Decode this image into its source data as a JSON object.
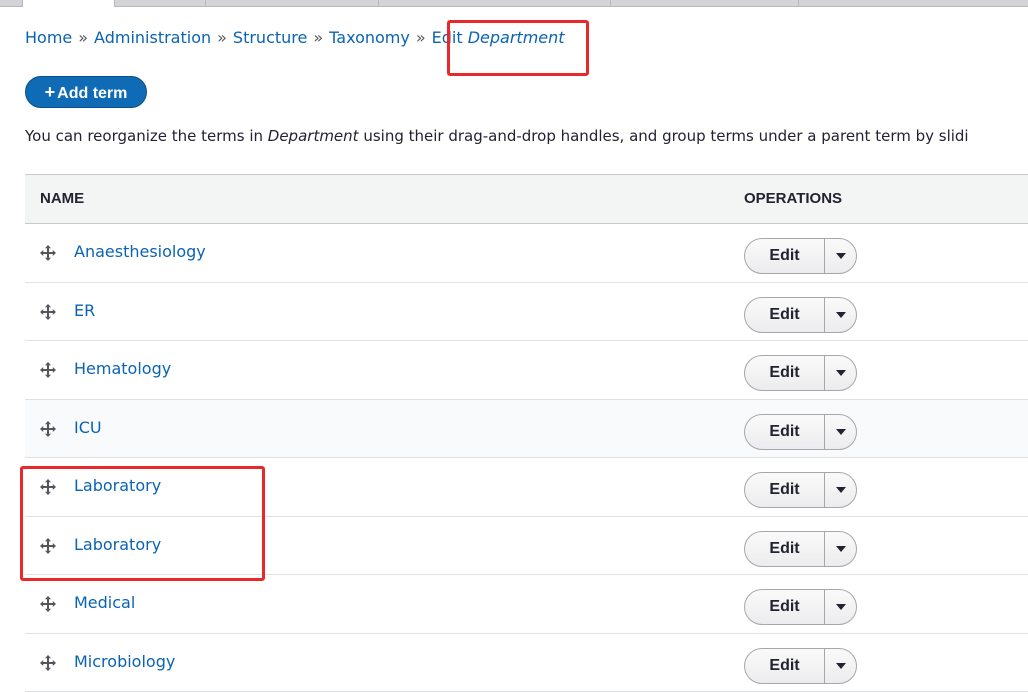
{
  "breadcrumb": {
    "home": "Home",
    "sep": "»",
    "administration": "Administration",
    "structure": "Structure",
    "taxonomy": "Taxonomy",
    "edit": "Edit",
    "vocabulary": "Department"
  },
  "add_term": {
    "plus": "+",
    "label": "Add term"
  },
  "help": {
    "before": "You can reorganize the terms in ",
    "vocabulary": "Department",
    "after": " using their drag-and-drop handles, and group terms under a parent term by slidi"
  },
  "table": {
    "headers": {
      "name": "NAME",
      "operations": "OPERATIONS"
    },
    "rows": [
      {
        "name": "Anaesthesiology",
        "edit": "Edit"
      },
      {
        "name": "ER",
        "edit": "Edit"
      },
      {
        "name": "Hematology",
        "edit": "Edit"
      },
      {
        "name": "ICU",
        "edit": "Edit"
      },
      {
        "name": "Laboratory",
        "edit": "Edit"
      },
      {
        "name": "Laboratory",
        "edit": "Edit"
      },
      {
        "name": "Medical",
        "edit": "Edit"
      },
      {
        "name": "Microbiology",
        "edit": "Edit"
      }
    ]
  },
  "icons": {
    "handle": "drag-handle-icon",
    "caret": "chevron-down-icon"
  },
  "colors": {
    "link": "#0a63b3",
    "primary_button": "#0f6bb5",
    "highlight": "#e8282a"
  }
}
